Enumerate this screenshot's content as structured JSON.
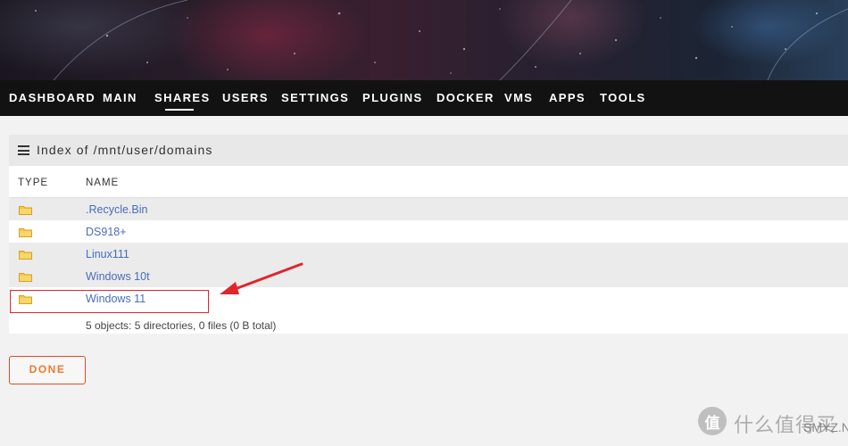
{
  "nav": {
    "items": [
      "DASHBOARD",
      "MAIN",
      "SHARES",
      "USERS",
      "SETTINGS",
      "PLUGINS",
      "DOCKER",
      "VMS",
      "APPS",
      "TOOLS"
    ],
    "active": "SHARES"
  },
  "panel": {
    "title": "Index of /mnt/user/domains",
    "columns": {
      "type": "TYPE",
      "name": "NAME"
    },
    "rows": [
      {
        "type_icon": "folder-icon",
        "name": ".Recycle.Bin"
      },
      {
        "type_icon": "folder-icon",
        "name": "DS918+"
      },
      {
        "type_icon": "folder-icon",
        "name": "Linux111"
      },
      {
        "type_icon": "folder-icon",
        "name": "Windows 10t"
      },
      {
        "type_icon": "folder-icon",
        "name": "Windows 11"
      }
    ],
    "summary": "5 objects: 5 directories, 0 files (0 B total)"
  },
  "actions": {
    "done_label": "DONE"
  },
  "watermark": {
    "logo_char": "值",
    "text": "什么值得买",
    "sub": "SMYZ.NET"
  },
  "colors": {
    "accent": "#f07a30",
    "link": "#486dba",
    "annotation": "#e0252c",
    "nav_bg": "#121212",
    "folder": "#f2c84b"
  }
}
